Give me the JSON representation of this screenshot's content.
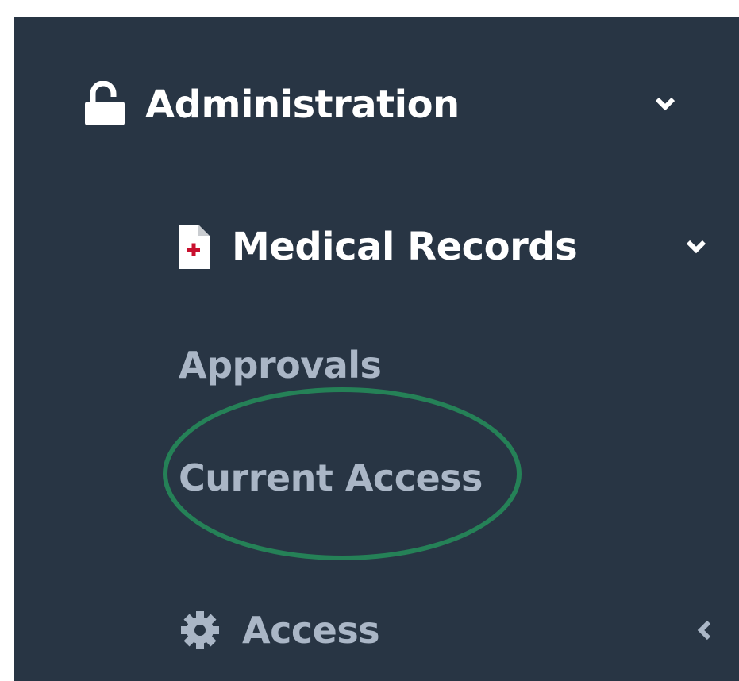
{
  "sidebar": {
    "items": [
      {
        "label": "Administration",
        "icon": "unlock-icon",
        "caret": "chevron-down-icon"
      },
      {
        "label": "Medical Records",
        "icon": "medical-file-icon",
        "caret": "chevron-down-icon"
      },
      {
        "label": "Approvals"
      },
      {
        "label": "Current Access"
      },
      {
        "label": "Access",
        "icon": "gear-icon",
        "caret": "chevron-left-icon"
      }
    ]
  },
  "colors": {
    "sidebar_bg": "#283544",
    "primary_text": "#ffffff",
    "secondary_text": "#aab6c6",
    "highlight": "#258157",
    "medical_cross": "#c8102e"
  }
}
